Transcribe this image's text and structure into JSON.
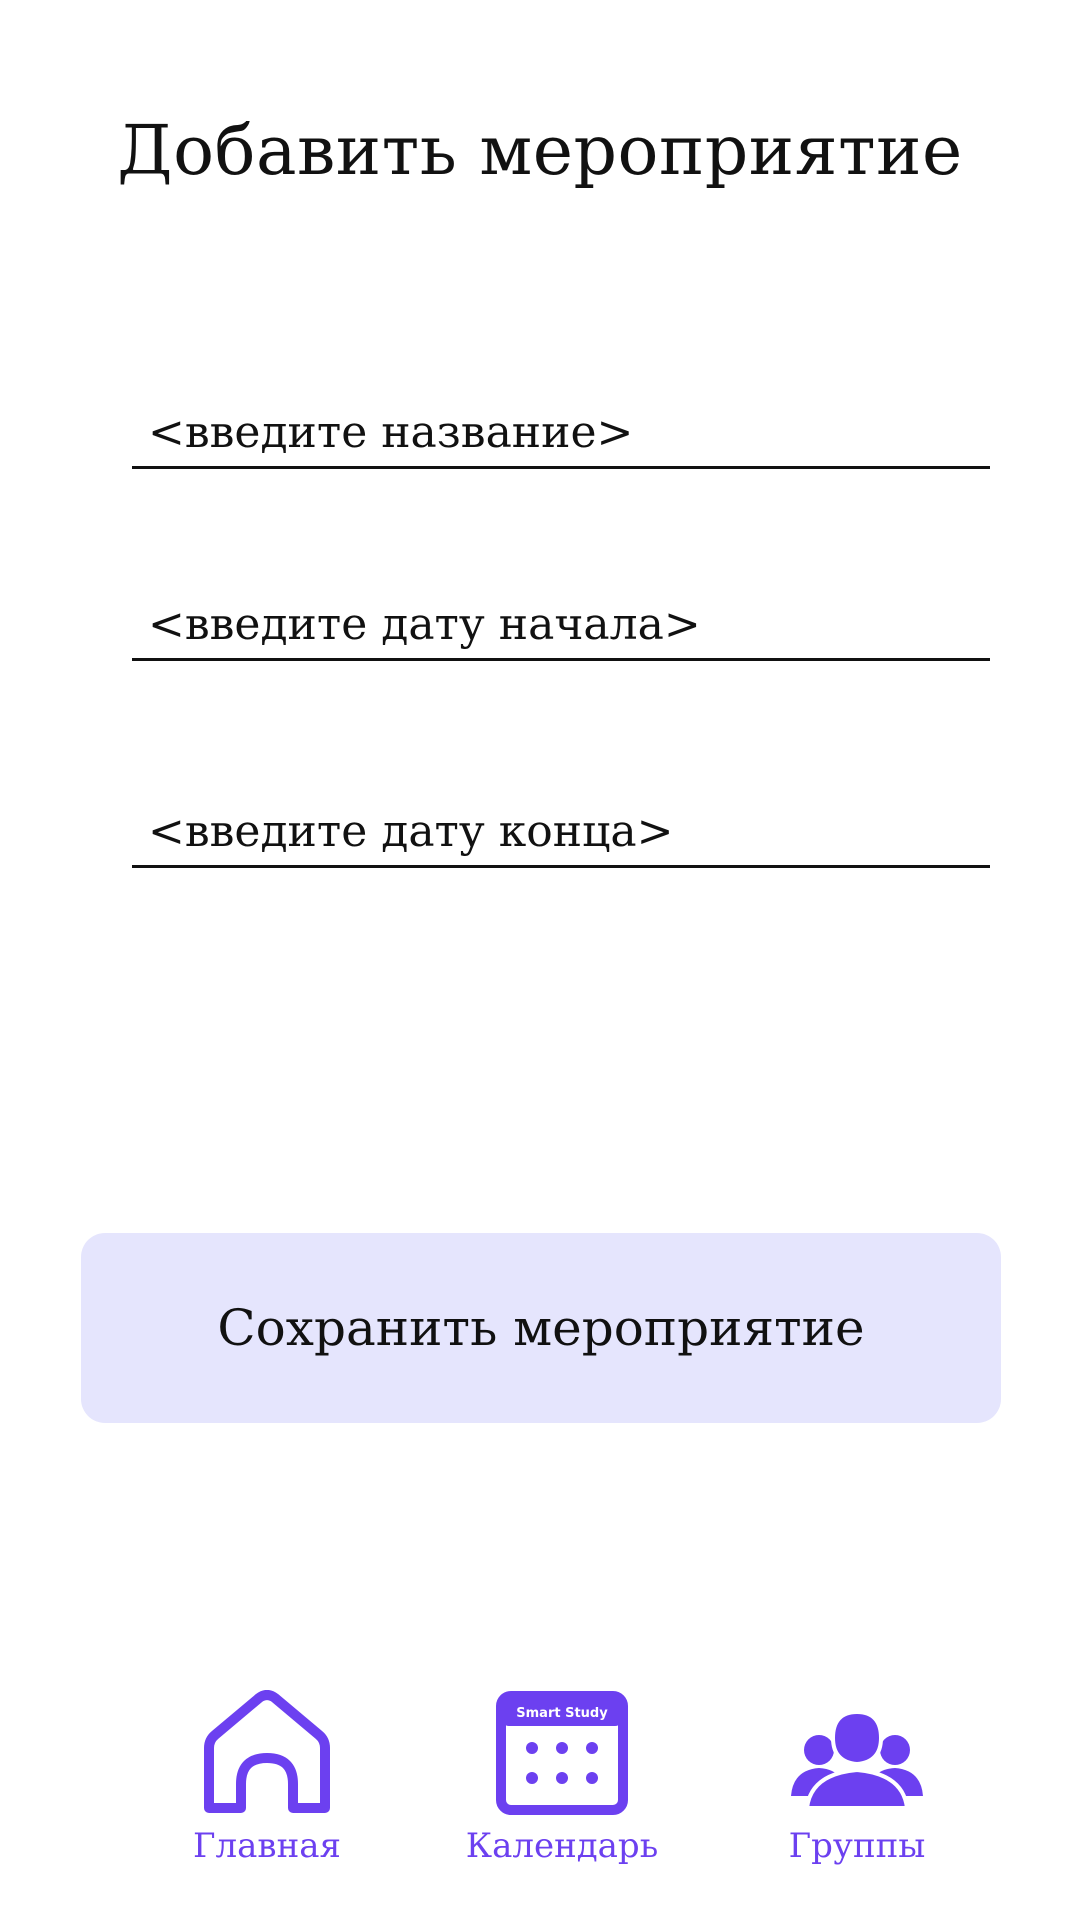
{
  "header": {
    "title": "Добавить мероприятие"
  },
  "form": {
    "name_placeholder": "<введите название>",
    "start_date_placeholder": "<введите дату начала>",
    "end_date_placeholder": "<введите дату конца>",
    "save_label": "Сохранить мероприятие"
  },
  "nav": {
    "home_label": "Главная",
    "calendar_label": "Календарь",
    "groups_label": "Группы",
    "calendar_icon_text": "Smart Study"
  },
  "colors": {
    "accent": "#6c40f0",
    "button_bg": "#e5e5fd"
  }
}
